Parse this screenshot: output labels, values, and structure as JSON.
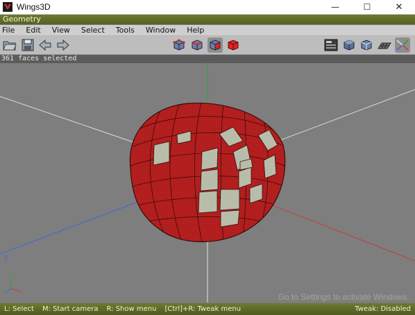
{
  "window": {
    "title": "Wings3D",
    "controls": {
      "minimize": "—",
      "maximize": "☐",
      "close": "✕"
    }
  },
  "geometry_header": "Geometry",
  "menu": [
    "File",
    "Edit",
    "View",
    "Select",
    "Tools",
    "Window",
    "Help"
  ],
  "toolbar": {
    "left": [
      "open-folder-icon",
      "save-icon",
      "undo-arrow-icon",
      "redo-arrow-icon"
    ],
    "selection_modes": [
      "vertex-mode-icon",
      "edge-mode-icon",
      "face-mode-icon",
      "body-mode-icon"
    ],
    "active_mode": "face-mode-icon",
    "right": [
      "workmode-icon",
      "smooth-shaded-cube-icon",
      "wireframe-cube-icon",
      "ground-plane-icon",
      "axes-icon"
    ]
  },
  "status": "361 faces selected",
  "axis_labels": {
    "z": "z"
  },
  "info_bar": {
    "hints": [
      "L: Select",
      "M: Start camera",
      "R: Show menu",
      "[Ctrl]+R: Tweak menu"
    ],
    "tweak_state": "Tweak: Disabled"
  },
  "watermark": "Go to Settings to activate Windows.",
  "colors": {
    "selected_face": "#b22222",
    "unselected_face": "#b8bdaa",
    "header_bar": "#5f6c28",
    "viewport_bg": "#7e7e7e"
  }
}
